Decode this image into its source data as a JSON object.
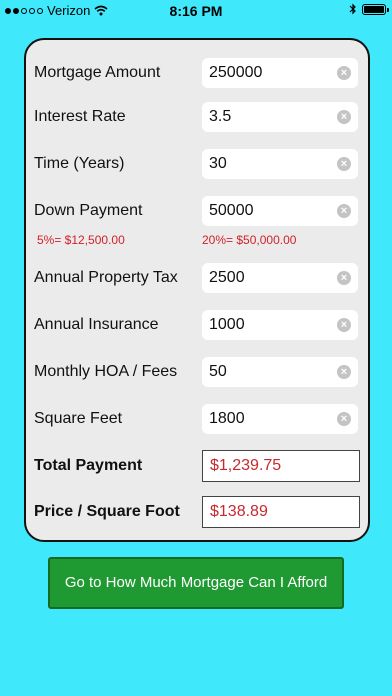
{
  "status": {
    "carrier": "Verizon",
    "time": "8:16 PM"
  },
  "form": {
    "fields": [
      {
        "label": "Mortgage Amount",
        "value": "250000"
      },
      {
        "label": "Interest Rate",
        "value": "3.5"
      },
      {
        "label": "Time (Years)",
        "value": "30"
      },
      {
        "label": "Down Payment",
        "value": "50000"
      },
      {
        "label": "Annual Property Tax",
        "value": "2500"
      },
      {
        "label": "Annual Insurance",
        "value": "1000"
      },
      {
        "label": "Monthly HOA / Fees",
        "value": "50"
      },
      {
        "label": "Square Feet",
        "value": "1800"
      }
    ],
    "down_payment_hints": {
      "five_percent": "5%= $12,500.00",
      "twenty_percent": "20%= $50,000.00"
    },
    "results": [
      {
        "label": "Total Payment",
        "value": "$1,239.75"
      },
      {
        "label": "Price / Square Foot",
        "value": "$138.89"
      }
    ],
    "clear_glyph": "×"
  },
  "afford_button_label": "Go to How Much Mortgage Can I Afford",
  "colors": {
    "background": "#3fe9fb",
    "button": "#1f9a33",
    "result_text": "#c8282d",
    "hint_text": "#d0222a"
  }
}
